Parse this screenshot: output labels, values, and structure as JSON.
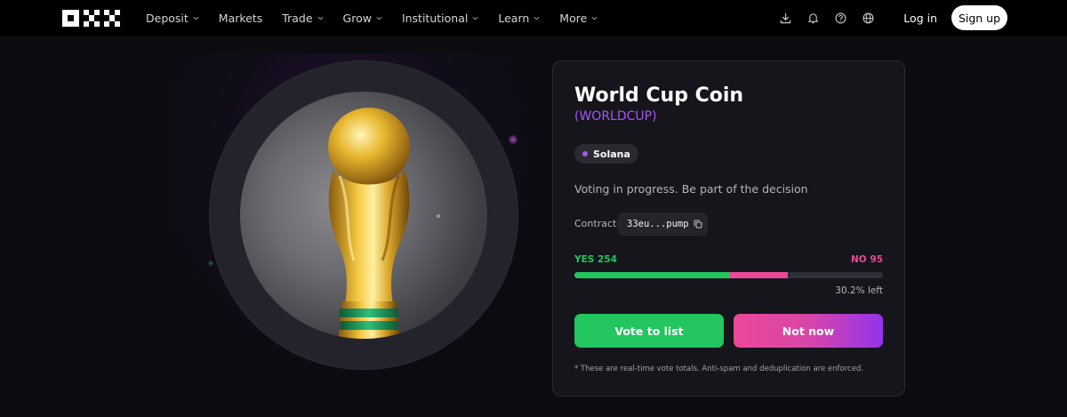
{
  "header": {
    "nav": [
      {
        "label": "Deposit",
        "has_dropdown": true
      },
      {
        "label": "Markets",
        "has_dropdown": false
      },
      {
        "label": "Trade",
        "has_dropdown": true
      },
      {
        "label": "Grow",
        "has_dropdown": true
      },
      {
        "label": "Institutional",
        "has_dropdown": true
      },
      {
        "label": "Learn",
        "has_dropdown": true
      },
      {
        "label": "More",
        "has_dropdown": true
      }
    ],
    "tools": [
      "download-icon",
      "bell-icon",
      "help-icon",
      "globe-icon"
    ],
    "login_label": "Log in",
    "signup_label": "Sign up"
  },
  "token": {
    "name": "World Cup Coin",
    "ticker": "(WORLDCUP)",
    "chain": "Solana",
    "status": "Voting in progress. Be part of the decision",
    "contract_label": "Contract:",
    "contract_value": "33eu...pump"
  },
  "vote": {
    "yes_label": "YES 254",
    "no_label": "NO 95",
    "yes_count": 254,
    "no_count": 95,
    "yes_fraction": 0.504,
    "no_fraction": 0.189,
    "remaining": "30.2% left",
    "vote_button": "Vote to list",
    "notnow_button": "Not now",
    "disclaimer": "* These are real-time vote totals. Anti-spam and deduplication are enforced."
  },
  "colors": {
    "yes": "#22c55e",
    "no": "#ec4899",
    "accent": "#a855f7",
    "background": "#0b0b10"
  }
}
